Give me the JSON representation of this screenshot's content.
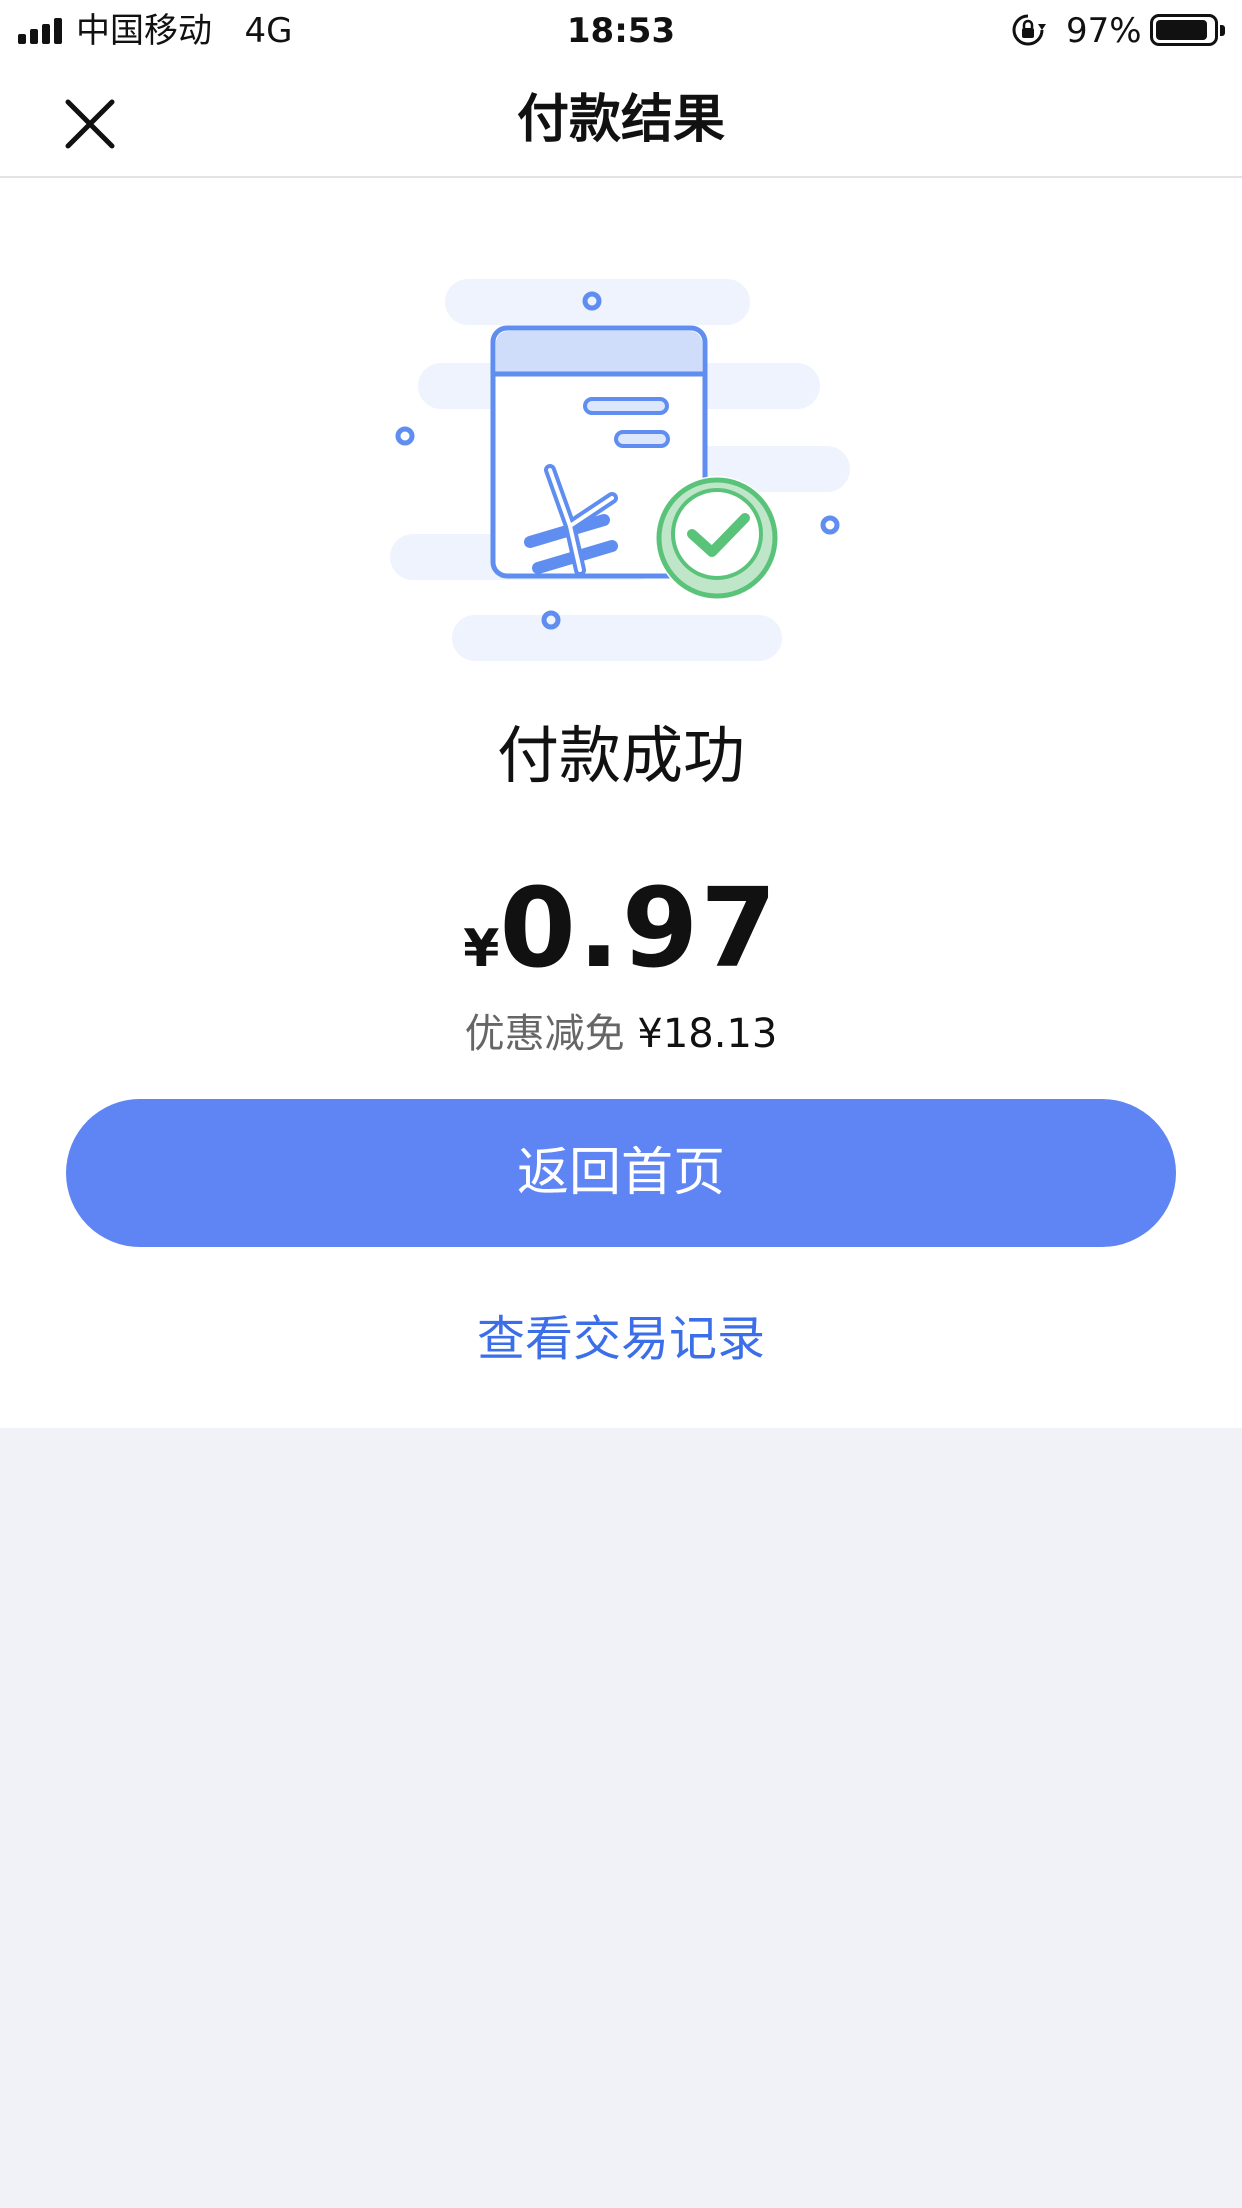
{
  "status_bar": {
    "carrier": "中国移动",
    "network": "4G",
    "time": "18:53",
    "battery_percent": "97%"
  },
  "nav": {
    "title": "付款结果",
    "close_icon": "close-icon"
  },
  "result": {
    "title": "付款成功",
    "currency_symbol": "¥",
    "amount": "0.97",
    "discount_label": "优惠减免",
    "discount_value": "¥18.13"
  },
  "actions": {
    "home_button": "返回首页",
    "records_link": "查看交易记录"
  },
  "colors": {
    "accent": "#5f85f4",
    "link": "#3b6ee8",
    "success": "#5ac37a",
    "background": "#f1f2f7"
  }
}
